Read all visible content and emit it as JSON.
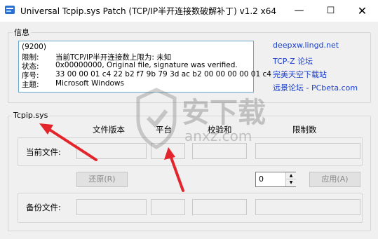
{
  "window": {
    "title": "Universal Tcpip.sys Patch  (TCP/IP半开连接数破解补丁) v1.2 x64",
    "minimize": "—",
    "maximize": "☐",
    "close": "✕"
  },
  "info_group": {
    "label": "信息",
    "lines": [
      {
        "key": "(9200)",
        "value": ""
      },
      {
        "key": "限制:",
        "value": "当前TCP/IP半开连接数上限为:   未知"
      },
      {
        "key": "状态:",
        "value": "0x00000000, Original file, signature was verified."
      },
      {
        "key": "序号:",
        "value": "33 00 00 01 c4 22 b2 f7 9b 79 3d ac b2 00 00 00 00 01 c4"
      },
      {
        "key": "主题:",
        "value": "Microsoft Windows"
      }
    ]
  },
  "links": [
    "deepxw.lingd.net",
    "TCP-Z 论坛",
    "完美天空下载站",
    "远景论坛 - PCbeta.com"
  ],
  "tcpip_group": {
    "label": "Tcpip.sys",
    "headers": [
      "文件版本",
      "平台",
      "校验和",
      "限制数"
    ],
    "current_label": "当前文件:",
    "backup_label": "备份文件:",
    "restore_button": "还原(R)",
    "apply_button": "应用(A)",
    "spinner_value": "0",
    "spinner_up": "▲",
    "spinner_down": "▼"
  },
  "watermark": {
    "text": "安下载",
    "sub": "anxz.com"
  },
  "icons": {
    "app": "app-icon",
    "annotation": "red-arrow-icon"
  },
  "colors": {
    "link": "#1a3fc9",
    "info_border": "#6aa6c9",
    "arrow": "#e3242b"
  }
}
